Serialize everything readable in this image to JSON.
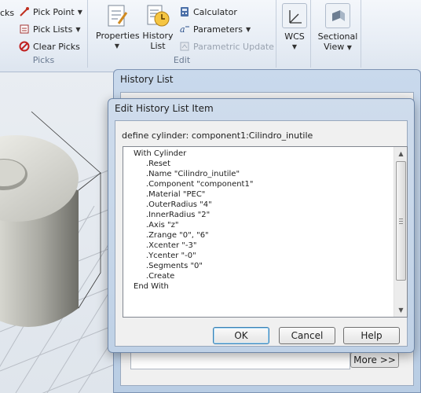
{
  "ribbon": {
    "picks": {
      "partial_left_label": "cks",
      "pick_point": "Pick Point",
      "pick_lists": "Pick Lists",
      "clear_picks": "Clear Picks",
      "group_label": "Picks"
    },
    "edit": {
      "properties": "Properties",
      "history_list_line1": "History",
      "history_list_line2": "List",
      "calculator": "Calculator",
      "parameters": "Parameters",
      "parametric_update": "Parametric Update",
      "group_label": "Edit"
    },
    "wcs": {
      "label": "WCS"
    },
    "sectional_view": {
      "line1": "Sectional",
      "line2": "View"
    }
  },
  "history_window": {
    "title": "History List",
    "more_button": "More >>"
  },
  "dialog": {
    "title": "Edit History List Item",
    "define_label": "define cylinder: component1:Cilindro_inutile",
    "code": "With Cylinder\n     .Reset\n     .Name \"Cilindro_inutile\"\n     .Component \"component1\"\n     .Material \"PEC\"\n     .OuterRadius \"4\"\n     .InnerRadius \"2\"\n     .Axis \"z\"\n     .Zrange \"0\", \"6\"\n     .Xcenter \"-3\"\n     .Ycenter \"-0\"\n     .Segments \"0\"\n     .Create\nEnd With",
    "ok_button": "OK",
    "cancel_button": "Cancel",
    "help_button": "Help"
  },
  "colors": {
    "ribbon_bg": "#e7edf5",
    "dialog_frame": "#cfdcec",
    "default_button_border": "#3c7fb1"
  }
}
